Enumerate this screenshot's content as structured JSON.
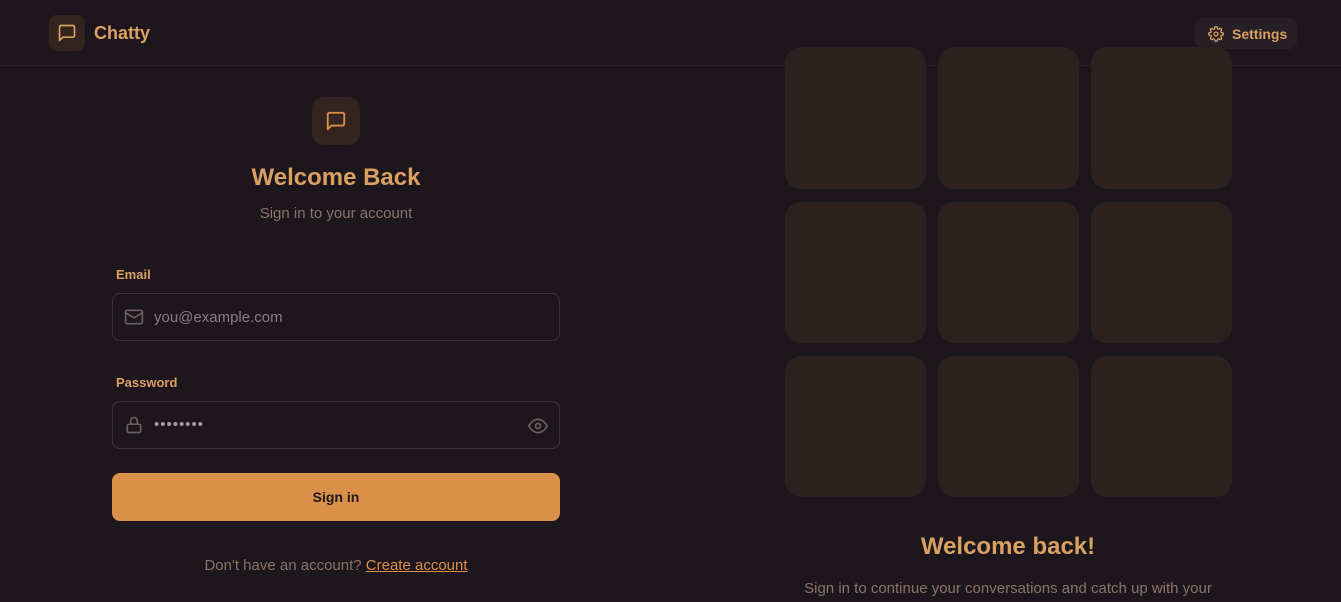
{
  "app": {
    "name": "Chatty"
  },
  "nav": {
    "settings_label": "Settings"
  },
  "login": {
    "title": "Welcome Back",
    "subtitle": "Sign in to your account",
    "email_label": "Email",
    "email_placeholder": "you@example.com",
    "password_label": "Password",
    "password_value": "••••••••",
    "submit_label": "Sign in",
    "no_account_text": "Don't have an account?",
    "create_account_link": "Create account"
  },
  "promo": {
    "title": "Welcome back!",
    "subtitle": "Sign in to continue your conversations and catch up with your"
  },
  "icons": {
    "brand": "message-square-icon",
    "settings": "gear-icon",
    "email": "mail-icon",
    "password": "lock-icon",
    "toggle_password": "eye-icon"
  },
  "colors": {
    "background": "#1e161d",
    "accent": "#d9a062",
    "button": "#db9049",
    "tile": "#2c211f",
    "muted_text": "#8a7468"
  }
}
